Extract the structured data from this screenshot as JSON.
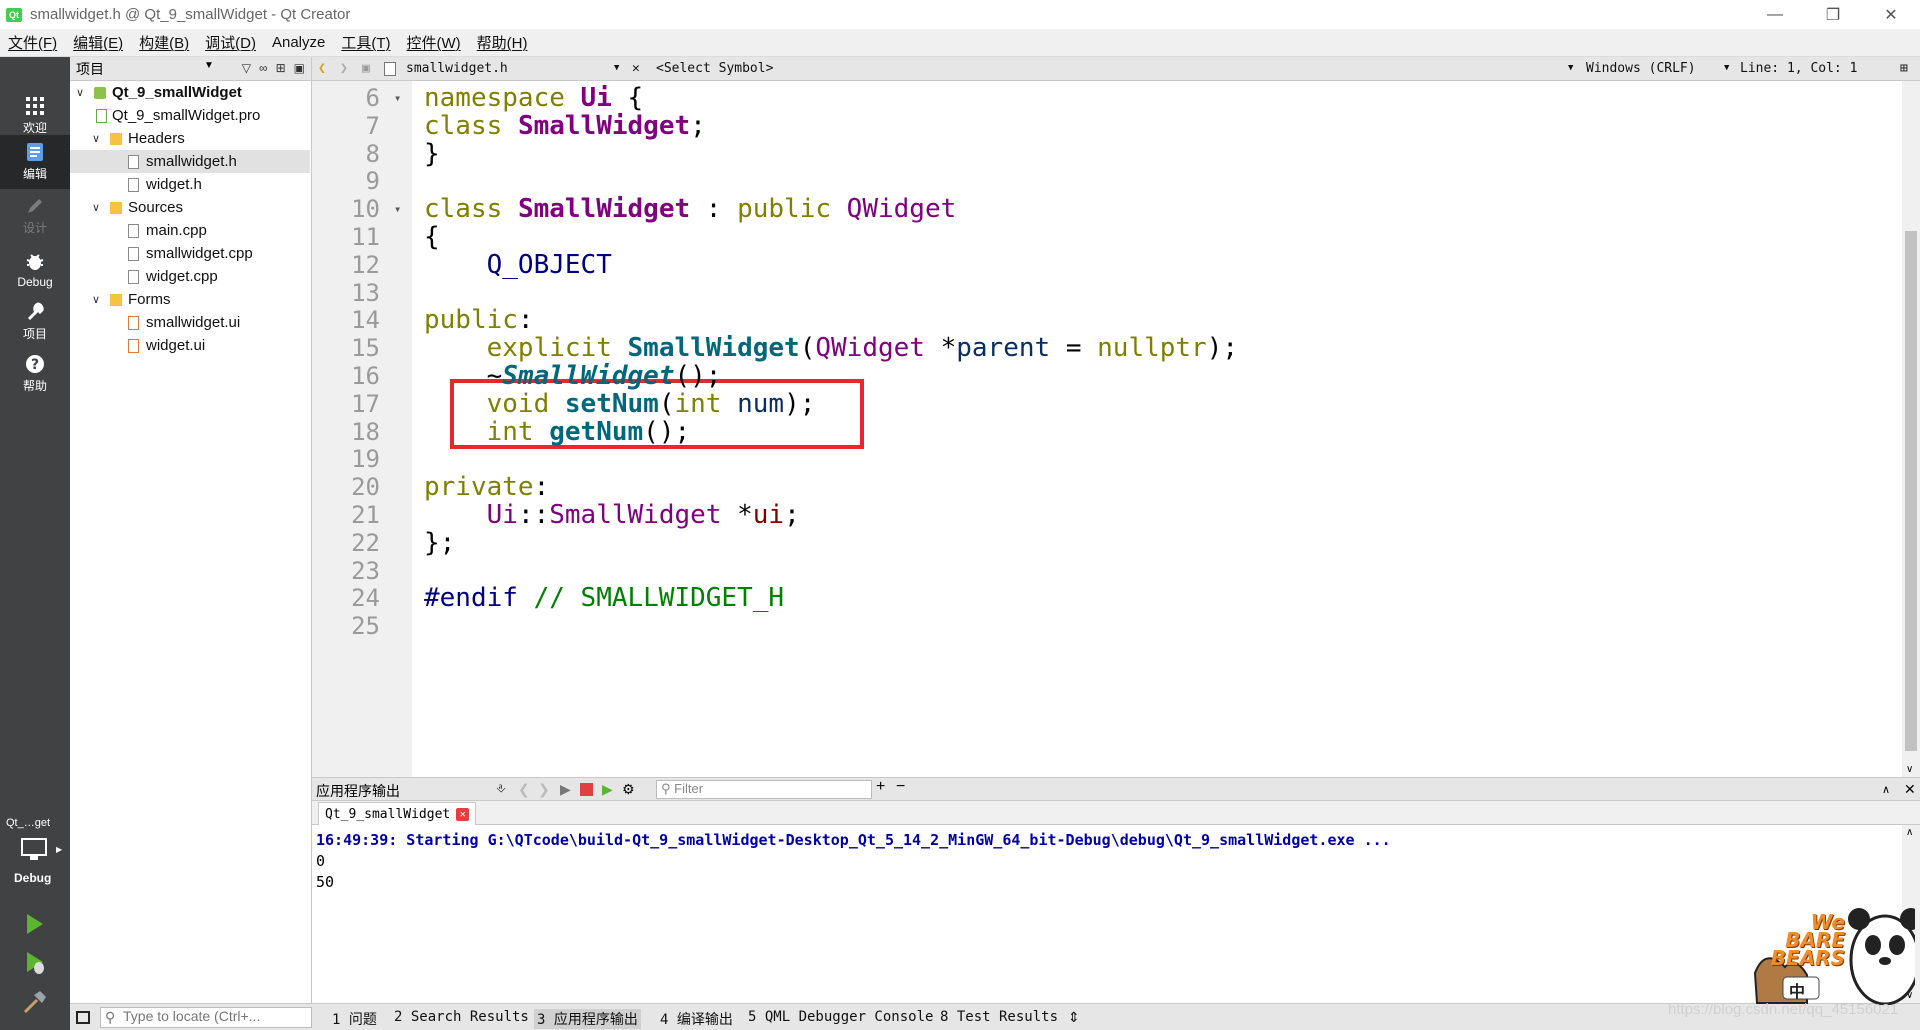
{
  "window": {
    "app_icon": "Qt",
    "title": "smallwidget.h @ Qt_9_smallWidget - Qt Creator"
  },
  "menu": [
    "文件(F)",
    "编辑(E)",
    "构建(B)",
    "调试(D)",
    "Analyze",
    "工具(T)",
    "控件(W)",
    "帮助(H)"
  ],
  "modes": [
    {
      "label": "欢迎",
      "icon": "grid-icon"
    },
    {
      "label": "编辑",
      "icon": "edit-document-icon"
    },
    {
      "label": "设计",
      "icon": "pencil-icon"
    },
    {
      "label": "Debug",
      "icon": "bug-icon"
    },
    {
      "label": "项目",
      "icon": "wrench-icon"
    },
    {
      "label": "帮助",
      "icon": "help-icon"
    }
  ],
  "kit": {
    "name": "Qt_…get",
    "mode": "Debug"
  },
  "project_pane": {
    "title": "项目",
    "tree": [
      {
        "label": "Qt_9_smallWidget",
        "level": 0,
        "expanded": true,
        "kind": "project"
      },
      {
        "label": "Qt_9_smallWidget.pro",
        "level": 1,
        "kind": "pro"
      },
      {
        "label": "Headers",
        "level": 1,
        "expanded": true,
        "kind": "folder-h"
      },
      {
        "label": "smallwidget.h",
        "level": 2,
        "kind": "file",
        "selected": true
      },
      {
        "label": "widget.h",
        "level": 2,
        "kind": "file"
      },
      {
        "label": "Sources",
        "level": 1,
        "expanded": true,
        "kind": "folder-cpp"
      },
      {
        "label": "main.cpp",
        "level": 2,
        "kind": "file"
      },
      {
        "label": "smallwidget.cpp",
        "level": 2,
        "kind": "file"
      },
      {
        "label": "widget.cpp",
        "level": 2,
        "kind": "file"
      },
      {
        "label": "Forms",
        "level": 1,
        "expanded": true,
        "kind": "folder-ui"
      },
      {
        "label": "smallwidget.ui",
        "level": 2,
        "kind": "ui"
      },
      {
        "label": "widget.ui",
        "level": 2,
        "kind": "ui"
      }
    ]
  },
  "editor_toolbar": {
    "file": "smallwidget.h",
    "symbol": "<Select Symbol>",
    "line_ending": "Windows (CRLF)",
    "position": "Line: 1, Col: 1"
  },
  "code": {
    "line_numbers": [
      "6",
      "7",
      "8",
      "9",
      "10",
      "11",
      "12",
      "13",
      "14",
      "15",
      "16",
      "17",
      "18",
      "19",
      "20",
      "21",
      "22",
      "23",
      "24",
      "25"
    ],
    "lines": [
      "namespace Ui {",
      "class SmallWidget;",
      "}",
      "",
      "class SmallWidget : public QWidget",
      "{",
      "    Q_OBJECT",
      "",
      "public:",
      "    explicit SmallWidget(QWidget *parent = nullptr);",
      "    ~SmallWidget();",
      "    void setNum(int num);",
      "    int getNum();",
      "",
      "private:",
      "    Ui::SmallWidget *ui;",
      "};",
      "",
      "#endif // SMALLWIDGET_H",
      ""
    ],
    "highlight_color": "#e8262d"
  },
  "output_pane": {
    "title": "应用程序输出",
    "filter_placeholder": "Filter",
    "tab_label": "Qt_9_smallWidget",
    "lines": [
      "16:49:39: Starting G:\\QTcode\\build-Qt_9_smallWidget-Desktop_Qt_5_14_2_MinGW_64_bit-Debug\\debug\\Qt_9_smallWidget.exe ...",
      "0",
      "50"
    ]
  },
  "status_bar": {
    "locator_placeholder": "Type to locate (Ctrl+...",
    "tabs": [
      "1 问题",
      "2 Search Results",
      "3 应用程序输出",
      "4 编译输出",
      "5 QML Debugger Console",
      "8 Test Results"
    ]
  },
  "overlay": {
    "mascot_brand": "We BARE BEARS",
    "mascot_badge": "中",
    "watermark": "https://blog.csdn.net/qq_45156021"
  }
}
